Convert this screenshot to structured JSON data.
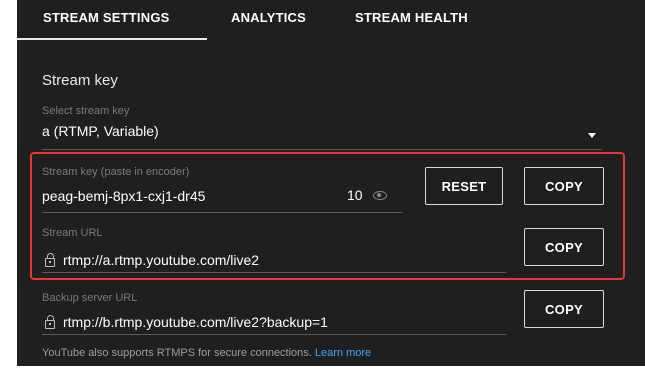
{
  "tabs": [
    {
      "label": "STREAM SETTINGS",
      "active": true
    },
    {
      "label": "ANALYTICS",
      "active": false
    },
    {
      "label": "STREAM HEALTH",
      "active": false
    }
  ],
  "stream_key_section": {
    "title": "Stream key",
    "select_label": "Select stream key",
    "select_value": "a (RTMP, Variable)"
  },
  "stream_key_field": {
    "label": "Stream key (paste in encoder)",
    "value": "peag-bemj-8px1-cxj1-dr45",
    "counter": "10",
    "reset_label": "RESET",
    "copy_label": "COPY"
  },
  "stream_url_field": {
    "label": "Stream URL",
    "value": "rtmp://a.rtmp.youtube.com/live2",
    "copy_label": "COPY"
  },
  "backup_url_field": {
    "label": "Backup server URL",
    "value": "rtmp://b.rtmp.youtube.com/live2?backup=1",
    "copy_label": "COPY"
  },
  "footer": {
    "text": "YouTube also supports RTMPS for secure connections.",
    "link": "Learn more"
  },
  "colors": {
    "background": "#1f1f1f",
    "highlight_border": "#e53935",
    "link": "#3ea6ff"
  },
  "icons": [
    "lock-icon",
    "eye-icon",
    "dropdown-arrow-icon"
  ]
}
